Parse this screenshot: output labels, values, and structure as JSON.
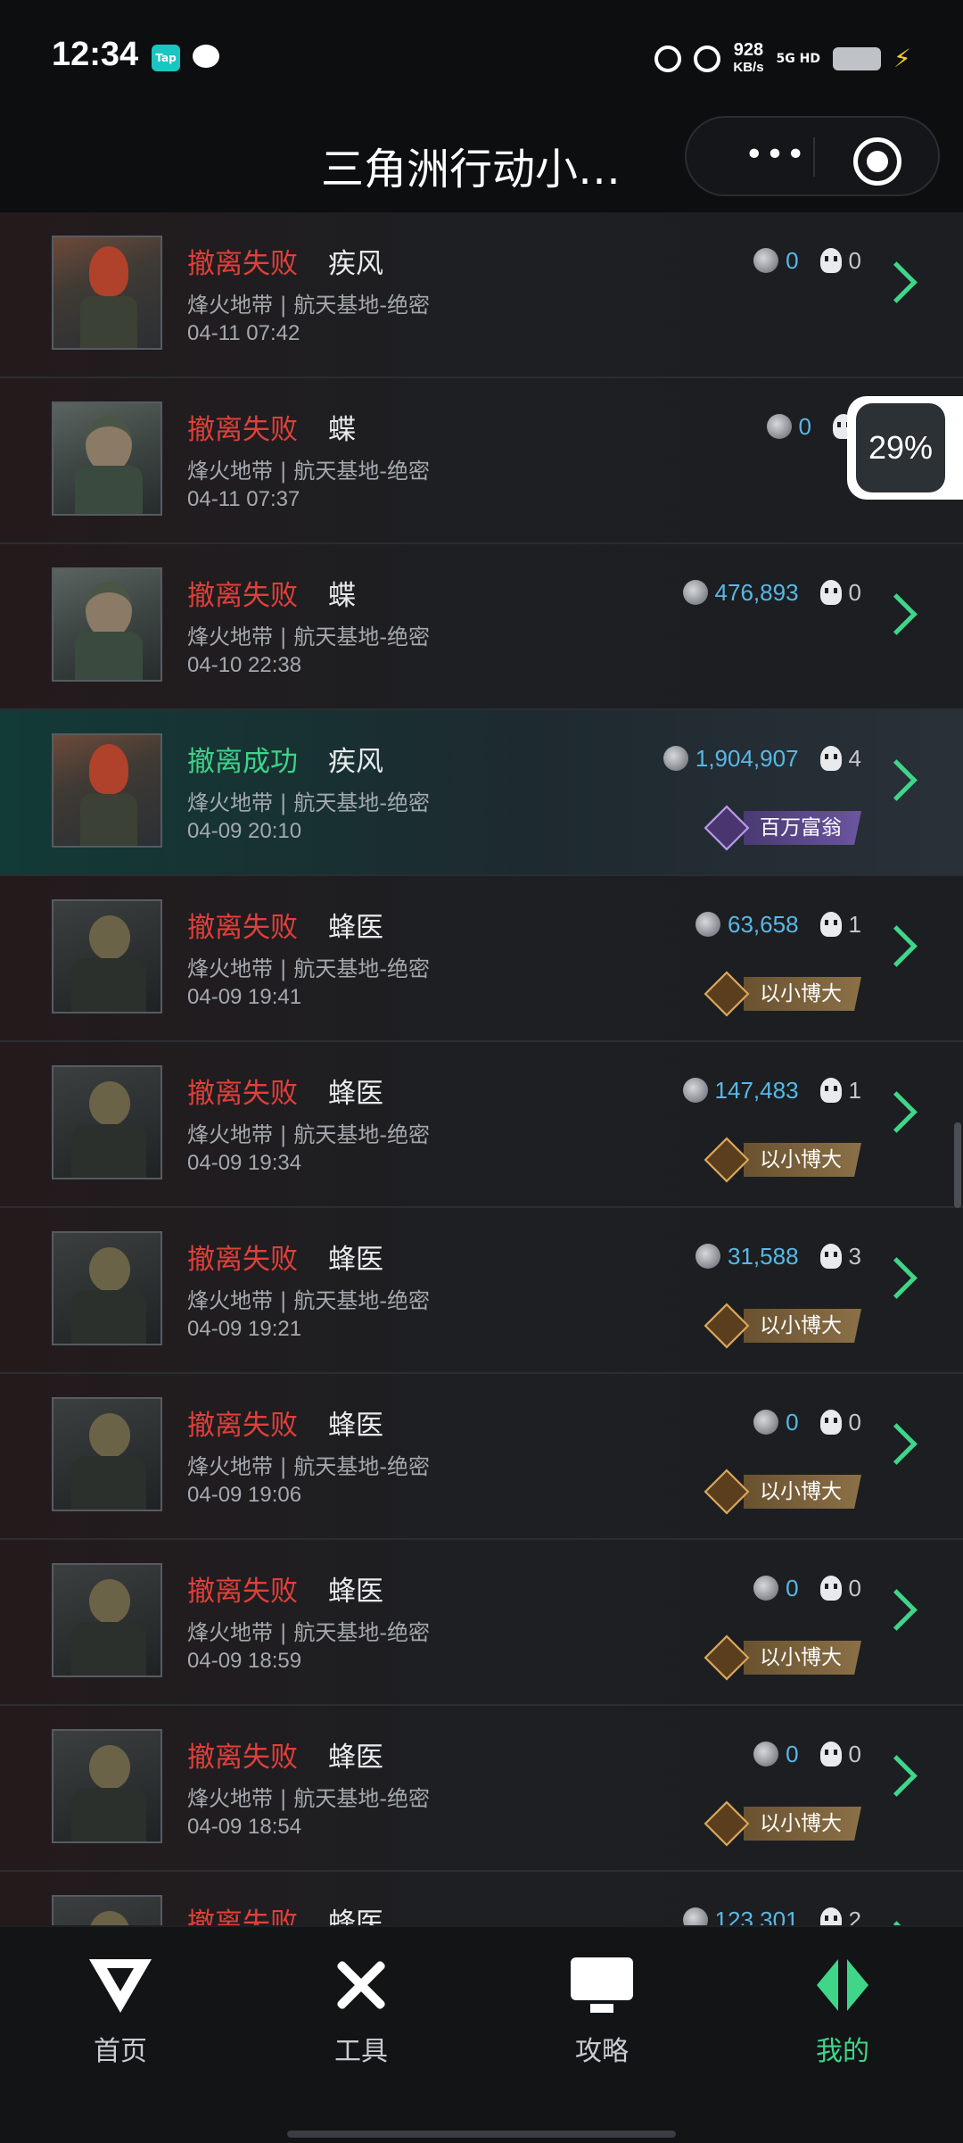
{
  "status_bar": {
    "time": "12:34",
    "tap_app": "Tap",
    "net_speed": "928",
    "net_unit": "KB/s",
    "net_type": "5G HD"
  },
  "title_bar": {
    "title": "三角洲行动小…",
    "more_icon": "•••"
  },
  "records": [
    {
      "status": "撤离失败",
      "result": "fail",
      "operator": "疾风",
      "map": "烽火地带 | 航天基地-绝密",
      "time": "04-11 07:42",
      "money": "0",
      "kills": "0",
      "badge": "",
      "avatar": "red"
    },
    {
      "status": "撤离失败",
      "result": "fail",
      "operator": "蝶",
      "map": "烽火地带 | 航天基地-绝密",
      "time": "04-11 07:37",
      "money": "0",
      "kills": "",
      "badge": "",
      "avatar": "camo"
    },
    {
      "status": "撤离失败",
      "result": "fail",
      "operator": "蝶",
      "map": "烽火地带 | 航天基地-绝密",
      "time": "04-10 22:38",
      "money": "476,893",
      "kills": "0",
      "badge": "",
      "avatar": "camo"
    },
    {
      "status": "撤离成功",
      "result": "ok",
      "operator": "疾风",
      "map": "烽火地带 | 航天基地-绝密",
      "time": "04-09 20:10",
      "money": "1,904,907",
      "kills": "4",
      "badge": "百万富翁",
      "avatar": "red"
    },
    {
      "status": "撤离失败",
      "result": "fail",
      "operator": "蜂医",
      "map": "烽火地带 | 航天基地-绝密",
      "time": "04-09 19:41",
      "money": "63,658",
      "kills": "1",
      "badge": "以小博大",
      "avatar": "soldier"
    },
    {
      "status": "撤离失败",
      "result": "fail",
      "operator": "蜂医",
      "map": "烽火地带 | 航天基地-绝密",
      "time": "04-09 19:34",
      "money": "147,483",
      "kills": "1",
      "badge": "以小博大",
      "avatar": "soldier"
    },
    {
      "status": "撤离失败",
      "result": "fail",
      "operator": "蜂医",
      "map": "烽火地带 | 航天基地-绝密",
      "time": "04-09 19:21",
      "money": "31,588",
      "kills": "3",
      "badge": "以小博大",
      "avatar": "soldier"
    },
    {
      "status": "撤离失败",
      "result": "fail",
      "operator": "蜂医",
      "map": "烽火地带 | 航天基地-绝密",
      "time": "04-09 19:06",
      "money": "0",
      "kills": "0",
      "badge": "以小博大",
      "avatar": "soldier"
    },
    {
      "status": "撤离失败",
      "result": "fail",
      "operator": "蜂医",
      "map": "烽火地带 | 航天基地-绝密",
      "time": "04-09 18:59",
      "money": "0",
      "kills": "0",
      "badge": "以小博大",
      "avatar": "soldier"
    },
    {
      "status": "撤离失败",
      "result": "fail",
      "operator": "蜂医",
      "map": "烽火地带 | 航天基地-绝密",
      "time": "04-09 18:54",
      "money": "0",
      "kills": "0",
      "badge": "以小博大",
      "avatar": "soldier"
    },
    {
      "status": "撤离失败",
      "result": "fail",
      "operator": "蜂医",
      "map": "",
      "time": "",
      "money": "123,301",
      "kills": "2",
      "badge": "",
      "avatar": "soldier"
    }
  ],
  "floating_widget": {
    "progress_text": "29%"
  },
  "bottom_nav": [
    {
      "label": "首页",
      "icon": "home-logo-icon",
      "active": false
    },
    {
      "label": "工具",
      "icon": "tools-icon",
      "active": false
    },
    {
      "label": "攻略",
      "icon": "guide-monitor-icon",
      "active": false
    },
    {
      "label": "我的",
      "icon": "me-logo-icon",
      "active": true
    }
  ],
  "colors": {
    "fail": "#e0403a",
    "success": "#3ed38a",
    "money": "#59b8e6",
    "accent": "#3fd68a"
  }
}
